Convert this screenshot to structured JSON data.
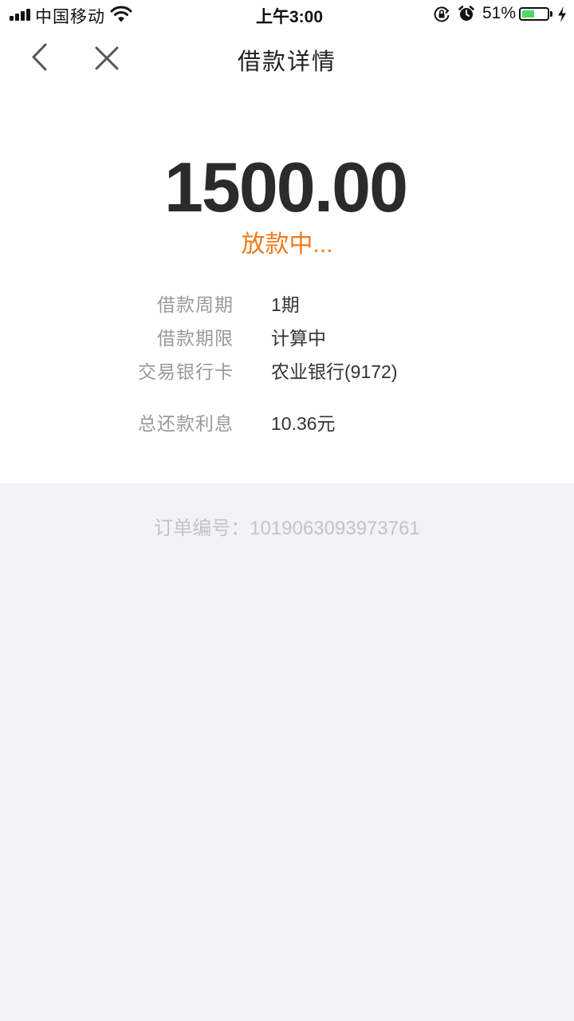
{
  "status_bar": {
    "carrier": "中国移动",
    "time": "上午3:00",
    "battery_percent": "51%",
    "battery_level": 0.51,
    "battery_fill_color": "#4CD964"
  },
  "nav": {
    "back_icon": "chevron-left-icon",
    "close_icon": "close-icon",
    "title": "借款详情"
  },
  "loan": {
    "amount": "1500.00",
    "status": "放款中...",
    "status_color": "#F07A1A"
  },
  "details": [
    {
      "label": "借款周期",
      "value": "1期"
    },
    {
      "label": "借款期限",
      "value": "计算中"
    },
    {
      "label": "交易银行卡",
      "value": "农业银行(9172)"
    },
    {
      "label": "总还款利息",
      "value": "10.36元"
    }
  ],
  "order": {
    "label": "订单编号：",
    "number": "1019063093973761"
  }
}
